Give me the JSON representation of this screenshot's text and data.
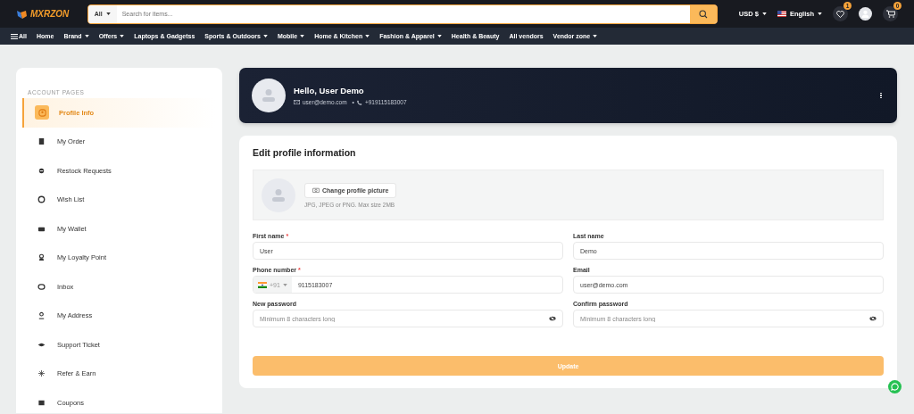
{
  "header": {
    "logo": "MXRZON",
    "search_category": "All",
    "search_placeholder": "Search for items...",
    "currency": "USD $",
    "language": "English",
    "wishlist_count": "1",
    "cart_count": "0"
  },
  "nav": [
    {
      "label": "All",
      "kind": "menu"
    },
    {
      "label": "Home",
      "kind": "link"
    },
    {
      "label": "Brand",
      "kind": "dropdown"
    },
    {
      "label": "Offers",
      "kind": "dropdown"
    },
    {
      "label": "Laptops & Gadgetss",
      "kind": "link"
    },
    {
      "label": "Sports & Outdoors",
      "kind": "dropdown"
    },
    {
      "label": "Mobile",
      "kind": "dropdown"
    },
    {
      "label": "Home & Kitchen",
      "kind": "dropdown"
    },
    {
      "label": "Fashion & Apparel",
      "kind": "dropdown"
    },
    {
      "label": "Health & Beauty",
      "kind": "link"
    },
    {
      "label": "All vendors",
      "kind": "link"
    },
    {
      "label": "Vendor zone",
      "kind": "dropdown"
    }
  ],
  "sidebar": {
    "heading": "ACCOUNT PAGES",
    "items": [
      {
        "label": "Profile Info",
        "selected": true
      },
      {
        "label": "My Order",
        "selected": false
      },
      {
        "label": "Restock Requests",
        "selected": false
      },
      {
        "label": "Wish List",
        "selected": false
      },
      {
        "label": "My Wallet",
        "selected": false
      },
      {
        "label": "My Loyalty Point",
        "selected": false
      },
      {
        "label": "Inbox",
        "selected": false
      },
      {
        "label": "My Address",
        "selected": false
      },
      {
        "label": "Support Ticket",
        "selected": false
      },
      {
        "label": "Refer & Earn",
        "selected": false
      },
      {
        "label": "Coupons",
        "selected": false
      }
    ]
  },
  "profile": {
    "greeting": "Hello, User Demo",
    "email": "user@demo.com",
    "separator": "•",
    "phone": "+919115183007"
  },
  "form": {
    "title": "Edit profile information",
    "change_picture": "Change profile picture",
    "picture_hint": "JPG, JPEG or PNG. Max size 2MB",
    "fields": [
      {
        "kind": "text",
        "label": "First name",
        "required_mark": "*",
        "value": "User"
      },
      {
        "kind": "text",
        "label": "Last name",
        "value": "Demo"
      },
      {
        "kind": "phone",
        "label": "Phone number",
        "required_mark": "*",
        "dial_code": "+91",
        "value": "9115183007"
      },
      {
        "kind": "text",
        "label": "Email",
        "value": "user@demo.com"
      },
      {
        "kind": "password",
        "label": "New password",
        "placeholder": "Minimum 8 characters long"
      },
      {
        "kind": "password",
        "label": "Confirm password",
        "placeholder": "Minimum 8 characters long"
      }
    ],
    "submit": "Update"
  }
}
